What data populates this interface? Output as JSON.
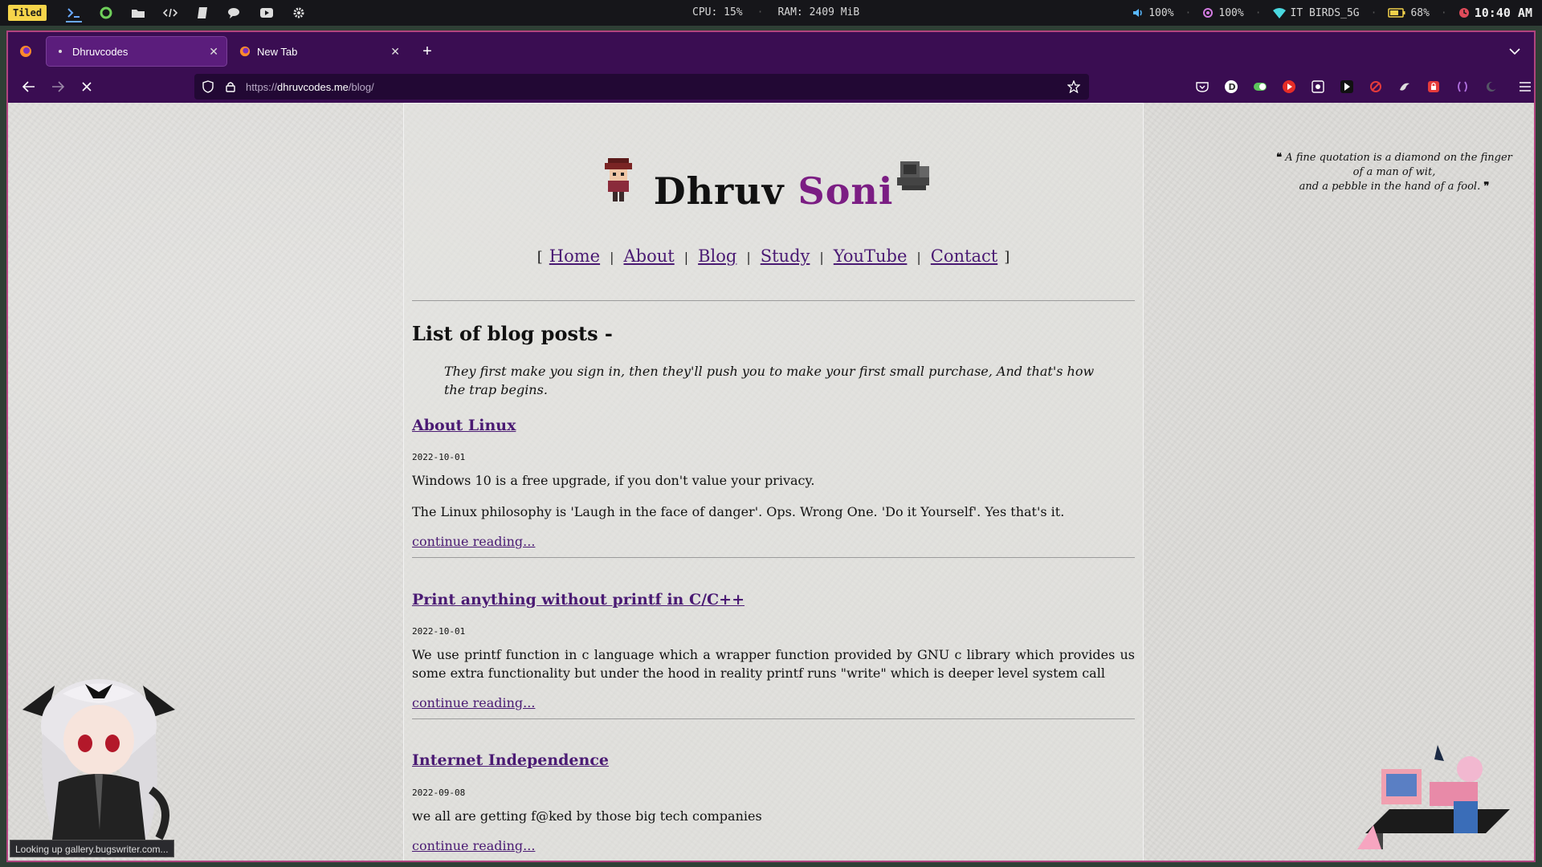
{
  "wm": {
    "layout": "Tiled",
    "cpu": "CPU: 15%",
    "ram": "RAM: 2409 MiB",
    "volume": "100%",
    "brightness": "100%",
    "wifi": "IT BIRDS_5G",
    "battery": "68%",
    "time": "10:40 AM"
  },
  "browser": {
    "tabs": [
      {
        "title": "Dhruvcodes",
        "active": true
      },
      {
        "title": "New Tab",
        "active": false
      }
    ],
    "url_prefix": "https://",
    "url_domain": "dhruvcodes.me",
    "url_path": "/blog/"
  },
  "site": {
    "title_first": "Dhruv",
    "title_last": "Soni",
    "menu": [
      "Home",
      "About",
      "Blog",
      "Study",
      "YouTube",
      "Contact"
    ],
    "bracket_open": "[",
    "bracket_close": "]",
    "separator": "|"
  },
  "side_quote": {
    "open_mark": "❝",
    "line1": "A fine quotation is a diamond on the finger",
    "line2": "of a man of wit,",
    "line3": "and a pebble in the hand of a fool.",
    "close_mark": "❞"
  },
  "blog": {
    "heading": "List of blog posts -",
    "quote": "They first make you sign in, then they'll push you to make your first small purchase, And that's how the trap begins.",
    "posts": [
      {
        "title": "About Linux",
        "date": "2022-10-01",
        "paragraphs": [
          "Windows 10 is a free upgrade, if you don't value your privacy.",
          "The Linux philosophy is 'Laugh in the face of danger'. Ops. Wrong One. 'Do it Yourself'. Yes that's it."
        ],
        "more": "continue reading..."
      },
      {
        "title": "Print anything without printf in C/C++",
        "date": "2022-10-01",
        "paragraphs": [
          "We use printf function in c language which a wrapper function provided by GNU c library which provides us some extra functionality but under the hood in reality printf runs \"write\" which is deeper level system call"
        ],
        "more": "continue reading..."
      },
      {
        "title": "Internet Independence",
        "date": "2022-09-08",
        "paragraphs": [
          "we all are getting f@ked by those big tech companies"
        ],
        "more": "continue reading..."
      }
    ]
  },
  "status_tip": "Looking up gallery.bugswriter.com...",
  "colors": {
    "accent": "#7b1d83",
    "link": "#4a1a73",
    "chrome": "#3a0d52",
    "border": "#b1447f"
  }
}
